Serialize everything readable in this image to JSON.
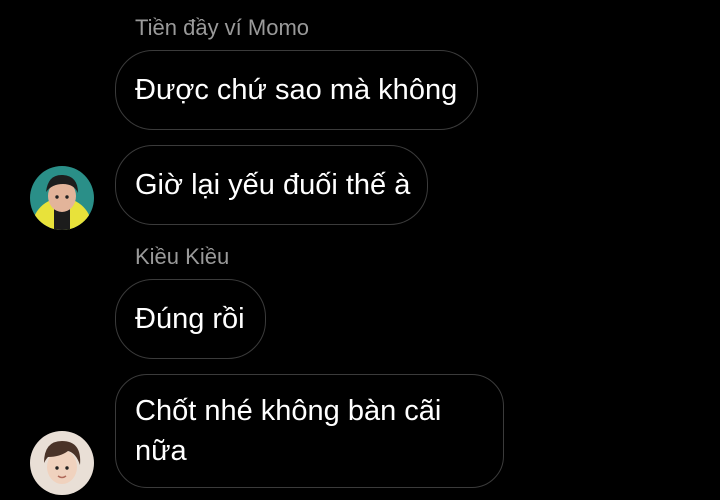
{
  "messages": [
    {
      "sender": "Tiền đầy ví Momo",
      "text": "Được chứ sao mà không"
    },
    {
      "text": "Giờ lại yếu đuối thế à"
    },
    {
      "sender": "Kiều Kiều",
      "text": "Đúng rồi"
    },
    {
      "text_line1": "Chốt nhé không bàn cãi",
      "text_line2": "nữa"
    }
  ],
  "avatars": [
    "avatar-person-yellow-jacket",
    "avatar-person-light-bg"
  ]
}
